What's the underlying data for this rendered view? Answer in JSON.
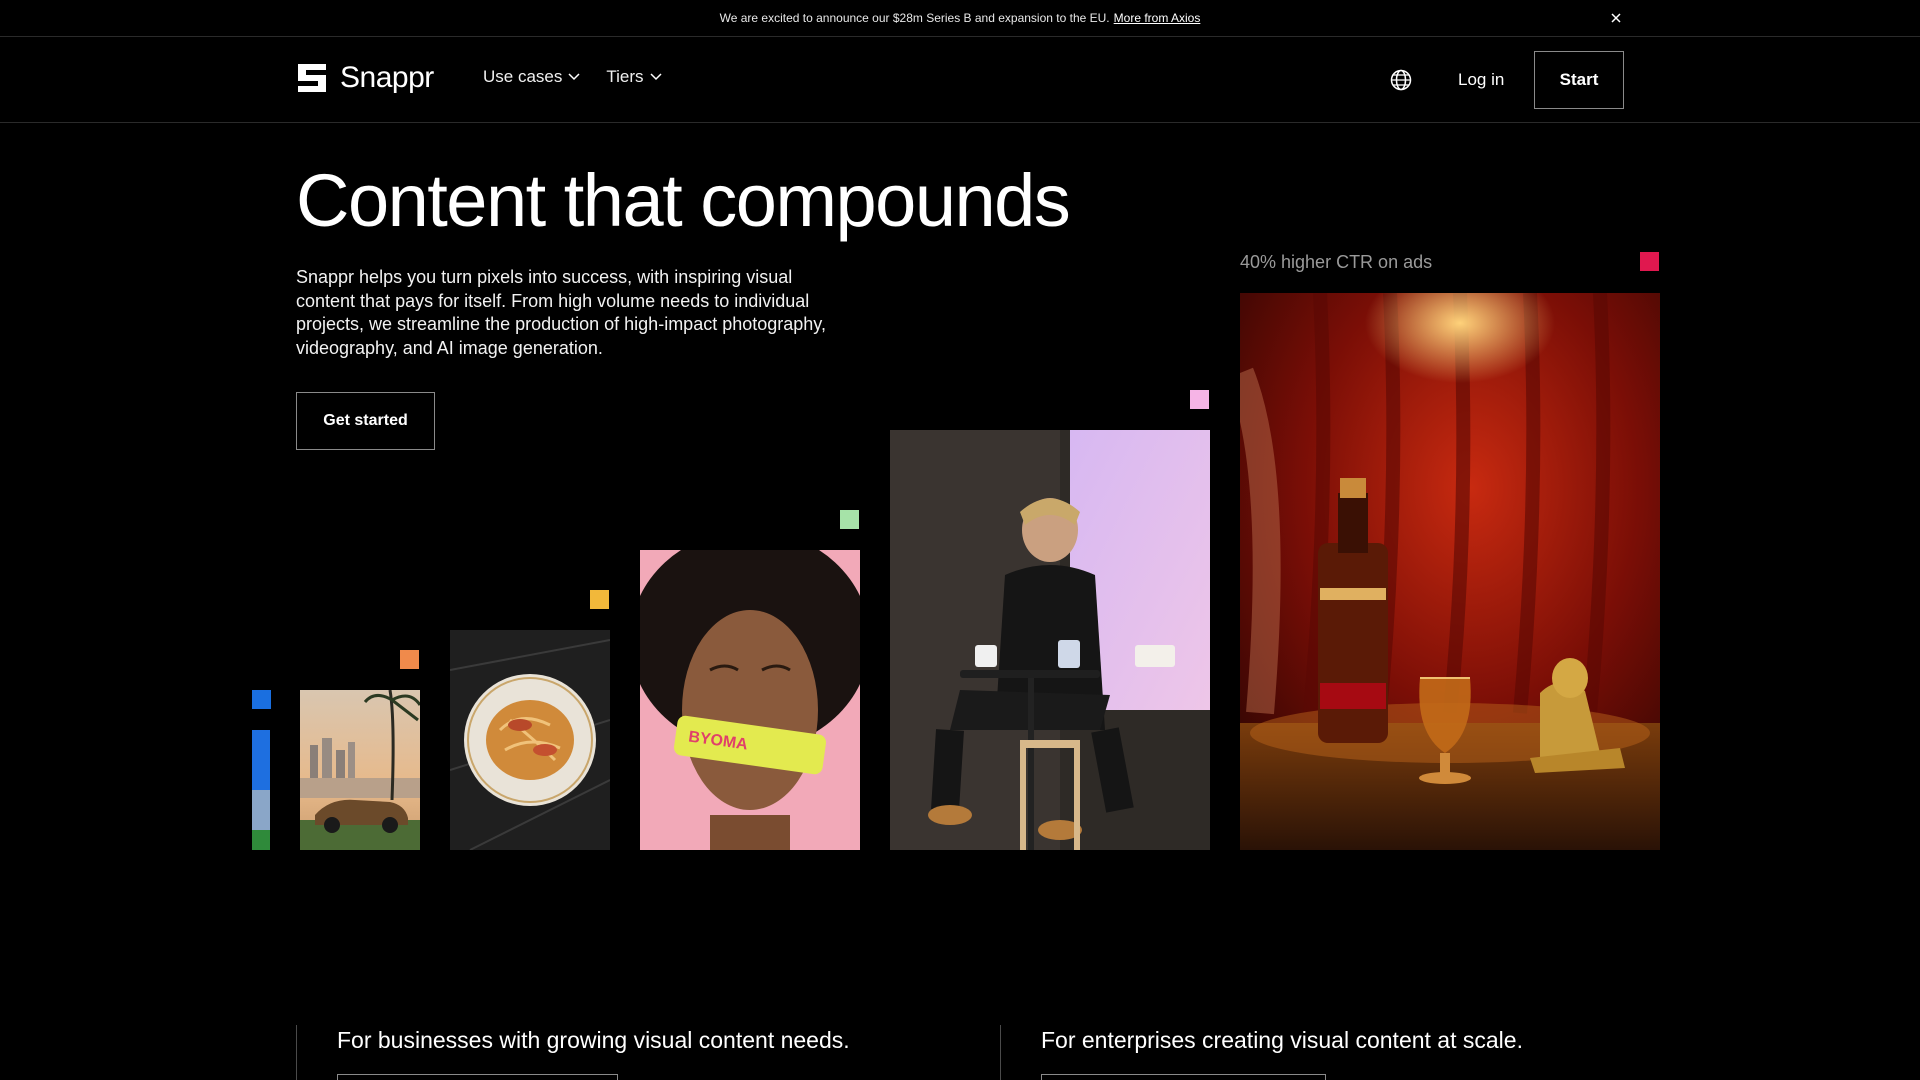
{
  "announcement": {
    "text": "We are excited to announce our $28m Series B and expansion to the EU.",
    "link": "More from Axios"
  },
  "header": {
    "logo_text": "Snappr",
    "nav": [
      {
        "label": "Use cases"
      },
      {
        "label": "Tiers"
      }
    ],
    "login_label": "Log in",
    "start_label": "Start"
  },
  "hero": {
    "title": "Content that compounds",
    "description": "Snappr helps you turn pixels into success, with inspiring visual content that pays for itself.  From high volume needs to individual projects, we streamline the production of high-impact photography, videography, and AI image generation.",
    "cta_label": "Get started"
  },
  "gallery": {
    "ctr_label": "40% higher CTR on ads",
    "accent_colors": {
      "blue": "#1a6fe0",
      "orange": "#f08a4b",
      "yellow": "#f2b83a",
      "green": "#a6e3a8",
      "pink": "#f6b4e6",
      "red": "#e0184f"
    },
    "images": [
      {
        "name": "partial-building-photo"
      },
      {
        "name": "car-sunset-photo"
      },
      {
        "name": "noodles-plate-photo"
      },
      {
        "name": "smiling-woman-byoma-photo",
        "brand": "BYOMA"
      },
      {
        "name": "speaker-stage-photo"
      },
      {
        "name": "whisky-bottle-photo"
      }
    ]
  },
  "sections": {
    "business": "For businesses with growing visual content needs.",
    "enterprise": "For enterprises creating visual content at scale."
  }
}
